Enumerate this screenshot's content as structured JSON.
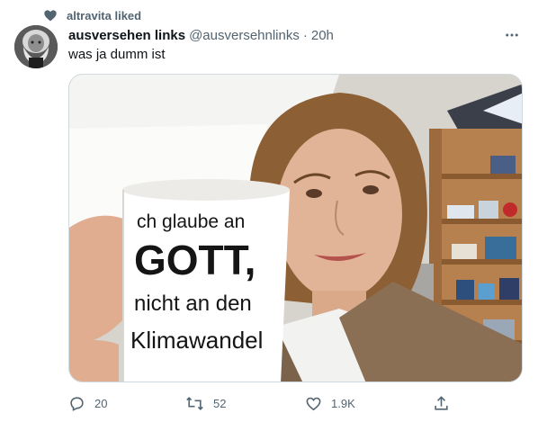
{
  "social_context": {
    "text": "altravita liked",
    "icon": "heart-icon"
  },
  "tweet": {
    "display_name": "ausversehen links",
    "handle": "@ausversehnlinks",
    "separator": "·",
    "time": "20h",
    "text": "was ja dumm ist",
    "more_icon": "more-dots-icon"
  },
  "media": {
    "alt": "Selfie of a woman holding a white mug",
    "mug_lines": [
      "ch glaube an",
      "GOTT,",
      "nicht an den",
      "Klimawandel"
    ]
  },
  "actions": {
    "reply_count": "20",
    "retweet_count": "52",
    "like_count": "1.9K"
  },
  "colors": {
    "text_primary": "#0f1419",
    "text_secondary": "#536471",
    "border": "#cfd9de"
  }
}
